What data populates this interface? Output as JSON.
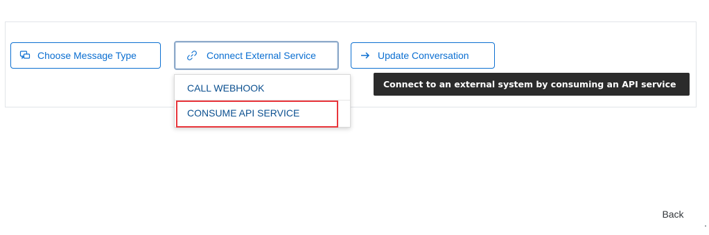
{
  "toolbar": {
    "choose_message_type": {
      "label": "Choose Message Type",
      "icon": "message-bubbles-icon"
    },
    "connect_external_service": {
      "label": "Connect External Service",
      "icon": "link-icon"
    },
    "update_conversation": {
      "label": "Update Conversation",
      "icon": "arrow-right-icon"
    }
  },
  "dropdown": {
    "items": [
      {
        "label": "CALL WEBHOOK"
      },
      {
        "label": "CONSUME API SERVICE",
        "highlighted": true
      }
    ]
  },
  "tooltip": {
    "text": "Connect to an external system by consuming an API service"
  },
  "footer": {
    "back_label": "Back"
  },
  "colors": {
    "accent": "#0a6ed1",
    "highlight": "#e8343a",
    "tooltip_bg": "#2b2b2b"
  }
}
